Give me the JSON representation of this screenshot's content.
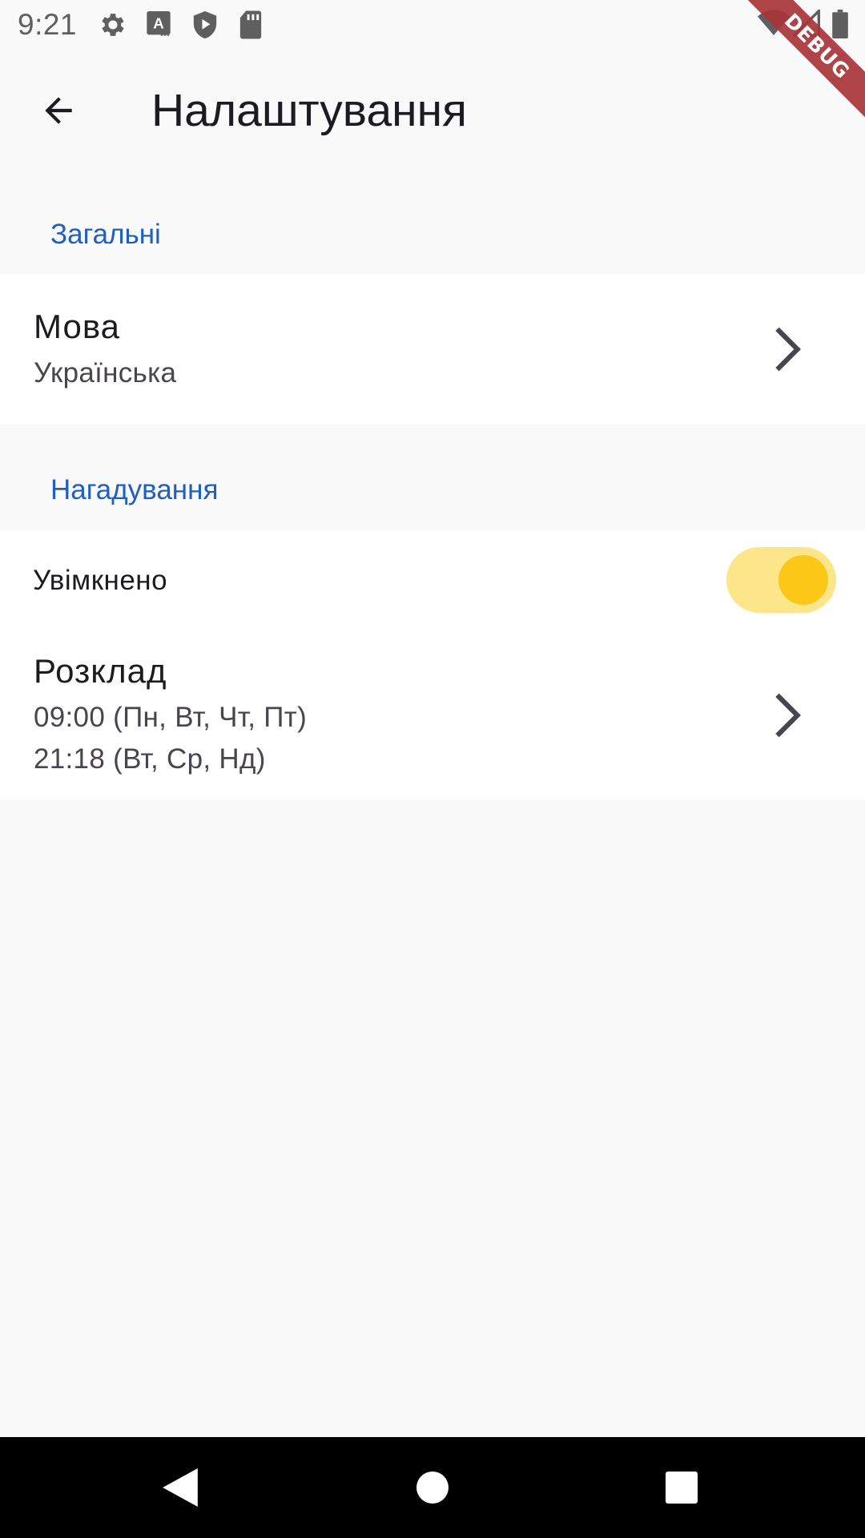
{
  "status_bar": {
    "time": "9:21",
    "icons_left": [
      "settings-icon",
      "a-icon",
      "shield-play-icon",
      "sd-card-icon"
    ],
    "icons_right": [
      "wifi-icon",
      "signal-icon",
      "battery-icon"
    ]
  },
  "debug_banner": "DEBUG",
  "app_bar": {
    "title": "Налаштування",
    "back_icon": "arrow-back-icon"
  },
  "sections": {
    "general": {
      "header": "Загальні",
      "language": {
        "title": "Мова",
        "value": "Українська"
      }
    },
    "reminders": {
      "header": "Нагадування",
      "enabled": {
        "label": "Увімкнено",
        "value": true
      },
      "schedule": {
        "title": "Розклад",
        "line1": "09:00 (Пн, Вт, Чт, Пт)",
        "line2": "21:18 (Вт, Ср, Нд)"
      }
    }
  },
  "colors": {
    "accent": "#1f5fbf",
    "switch_track": "#fde58a",
    "switch_thumb": "#fbc915",
    "background": "#f9f9f9"
  },
  "nav_bar": {
    "buttons": [
      "back-icon",
      "home-icon",
      "recents-icon"
    ]
  }
}
